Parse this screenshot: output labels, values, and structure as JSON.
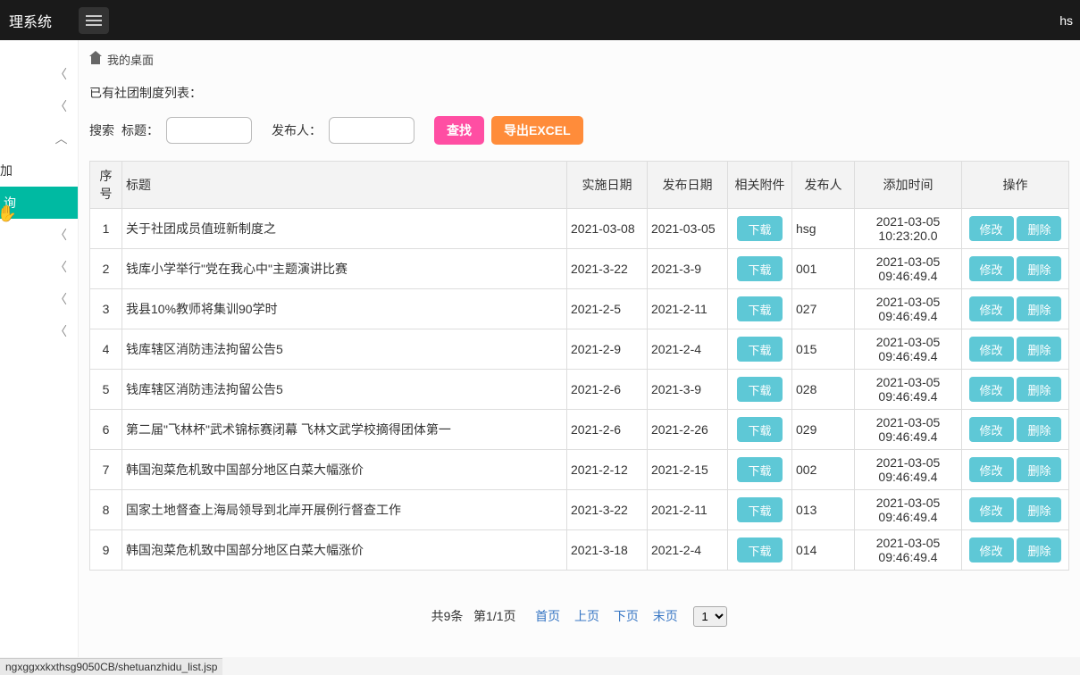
{
  "header": {
    "brand": "理系统",
    "user": "hs"
  },
  "breadcrumb": {
    "home": "我的桌面"
  },
  "sidebar": {
    "items": [
      {
        "label": "",
        "arrow": "left"
      },
      {
        "label": "",
        "arrow": "left"
      },
      {
        "label": "",
        "arrow": "down"
      },
      {
        "label": "加",
        "arrow": ""
      },
      {
        "label": "询",
        "arrow": "",
        "active": true
      },
      {
        "label": "",
        "arrow": "left"
      },
      {
        "label": "",
        "arrow": "left"
      },
      {
        "label": "",
        "arrow": "left"
      },
      {
        "label": "",
        "arrow": "left"
      }
    ]
  },
  "content": {
    "caption": "已有社团制度列表：",
    "search": {
      "label": "搜索",
      "title_label": "标题：",
      "publisher_label": "发布人：",
      "search_btn": "查找",
      "export_btn": "导出EXCEL"
    },
    "columns": {
      "idx": "序号",
      "title": "标题",
      "impl_date": "实施日期",
      "pub_date": "发布日期",
      "attachment": "相关附件",
      "publisher": "发布人",
      "add_time": "添加时间",
      "ops": "操作"
    },
    "download_label": "下载",
    "modify_label": "修改",
    "delete_label": "删除",
    "rows": [
      {
        "idx": "1",
        "title": "关于社团成员值班新制度之",
        "impl_date": "2021-03-08",
        "pub_date": "2021-03-05",
        "publisher": "hsg",
        "add_time": "2021-03-05 10:23:20.0"
      },
      {
        "idx": "2",
        "title": "钱库小学举行\"党在我心中\"主题演讲比赛",
        "impl_date": "2021-3-22",
        "pub_date": "2021-3-9",
        "publisher": "001",
        "add_time": "2021-03-05 09:46:49.4"
      },
      {
        "idx": "3",
        "title": "我县10%教师将集训90学时",
        "impl_date": "2021-2-5",
        "pub_date": "2021-2-11",
        "publisher": "027",
        "add_time": "2021-03-05 09:46:49.4"
      },
      {
        "idx": "4",
        "title": "钱库辖区消防违法拘留公告5",
        "impl_date": "2021-2-9",
        "pub_date": "2021-2-4",
        "publisher": "015",
        "add_time": "2021-03-05 09:46:49.4"
      },
      {
        "idx": "5",
        "title": "钱库辖区消防违法拘留公告5",
        "impl_date": "2021-2-6",
        "pub_date": "2021-3-9",
        "publisher": "028",
        "add_time": "2021-03-05 09:46:49.4"
      },
      {
        "idx": "6",
        "title": "第二届\"飞林杯\"武术锦标赛闭幕 飞林文武学校摘得团体第一",
        "impl_date": "2021-2-6",
        "pub_date": "2021-2-26",
        "publisher": "029",
        "add_time": "2021-03-05 09:46:49.4"
      },
      {
        "idx": "7",
        "title": "韩国泡菜危机致中国部分地区白菜大幅涨价",
        "impl_date": "2021-2-12",
        "pub_date": "2021-2-15",
        "publisher": "002",
        "add_time": "2021-03-05 09:46:49.4"
      },
      {
        "idx": "8",
        "title": "国家土地督查上海局领导到北岸开展例行督查工作",
        "impl_date": "2021-3-22",
        "pub_date": "2021-2-11",
        "publisher": "013",
        "add_time": "2021-03-05 09:46:49.4"
      },
      {
        "idx": "9",
        "title": "韩国泡菜危机致中国部分地区白菜大幅涨价",
        "impl_date": "2021-3-18",
        "pub_date": "2021-2-4",
        "publisher": "014",
        "add_time": "2021-03-05 09:46:49.4"
      }
    ],
    "pagination": {
      "total": "共9条",
      "page": "第1/1页",
      "first": "首页",
      "prev": "上页",
      "next": "下页",
      "last": "末页",
      "select": "1"
    }
  },
  "status_bar": "ngxggxxkxthsg9050CB/shetuanzhidu_list.jsp"
}
